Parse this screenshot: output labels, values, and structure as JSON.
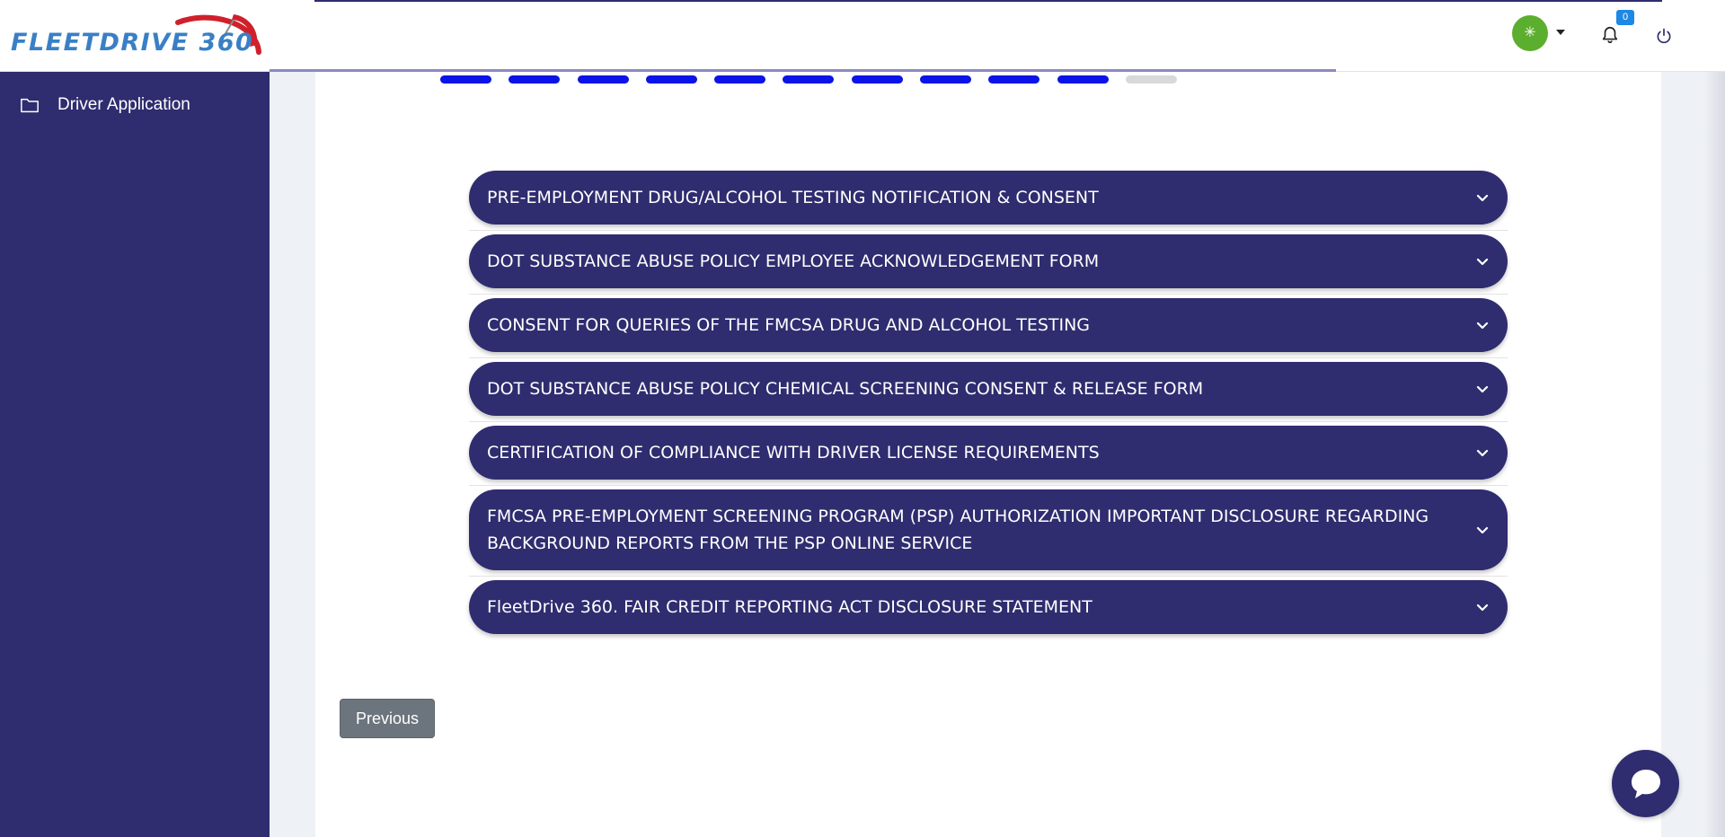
{
  "brand": {
    "name": "FLEETDRIVE 360",
    "logo_colors": {
      "text": "#3a7fc6",
      "arc": "#d0202b"
    }
  },
  "header": {
    "avatar_symbol": "✳",
    "avatar_color": "#5cae2e",
    "notifications_count": "0",
    "icons": [
      "caret-down-icon",
      "bell-icon",
      "power-icon"
    ]
  },
  "sidebar": {
    "items": [
      {
        "label": "Driver Application",
        "icon": "folder-icon"
      }
    ]
  },
  "progress": {
    "total_steps": 11,
    "completed_steps": 10,
    "active_color": "#0a14e6",
    "inactive_color": "#d9d9d9"
  },
  "sections": [
    {
      "title": "PRE-EMPLOYMENT DRUG/ALCOHOL TESTING NOTIFICATION & CONSENT"
    },
    {
      "title": "DOT SUBSTANCE ABUSE POLICY EMPLOYEE ACKNOWLEDGEMENT FORM"
    },
    {
      "title": "CONSENT FOR QUERIES OF THE FMCSA DRUG AND ALCOHOL TESTING"
    },
    {
      "title": "DOT SUBSTANCE ABUSE POLICY CHEMICAL SCREENING CONSENT & RELEASE FORM"
    },
    {
      "title": "CERTIFICATION OF COMPLIANCE WITH DRIVER LICENSE REQUIREMENTS"
    },
    {
      "title": "FMCSA PRE-EMPLOYMENT SCREENING PROGRAM (PSP) AUTHORIZATION IMPORTANT DISCLOSURE REGARDING BACKGROUND REPORTS FROM THE PSP ONLINE SERVICE"
    },
    {
      "title": "FleetDrive 360. FAIR CREDIT REPORTING ACT DISCLOSURE STATEMENT"
    }
  ],
  "footer": {
    "previous_label": "Previous"
  },
  "chat": {
    "icon": "chat-bubble-icon"
  },
  "colors": {
    "primary": "#2f2c6f",
    "secondary_button": "#6c757d"
  }
}
